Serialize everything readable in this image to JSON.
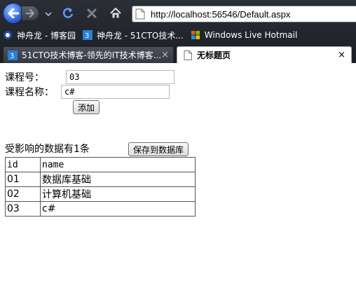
{
  "browser": {
    "address_url": "http://localhost:56546/Default.aspx",
    "favorites": [
      {
        "label": "神舟龙 - 博客园"
      },
      {
        "label": "神舟龙 - 51CTO技术..."
      },
      {
        "label": "Windows Live Hotmail"
      }
    ],
    "tabs": [
      {
        "label": "51CTO技术博客-领先的IT技术博客...",
        "close": "×"
      },
      {
        "label": "无标题页",
        "close": "×"
      }
    ]
  },
  "form": {
    "course_no_label": "课程号：",
    "course_no_value": "03",
    "course_name_label": "课程名称：",
    "course_name_value": "c#",
    "add_button": "添加",
    "affected_text": "受影响的数据有1条",
    "save_button": "保存到数据库"
  },
  "table": {
    "headers": [
      "id",
      "name"
    ],
    "rows": [
      [
        "01",
        "数据库基础"
      ],
      [
        "02",
        "计算机基础"
      ],
      [
        "03",
        "c#"
      ]
    ]
  }
}
